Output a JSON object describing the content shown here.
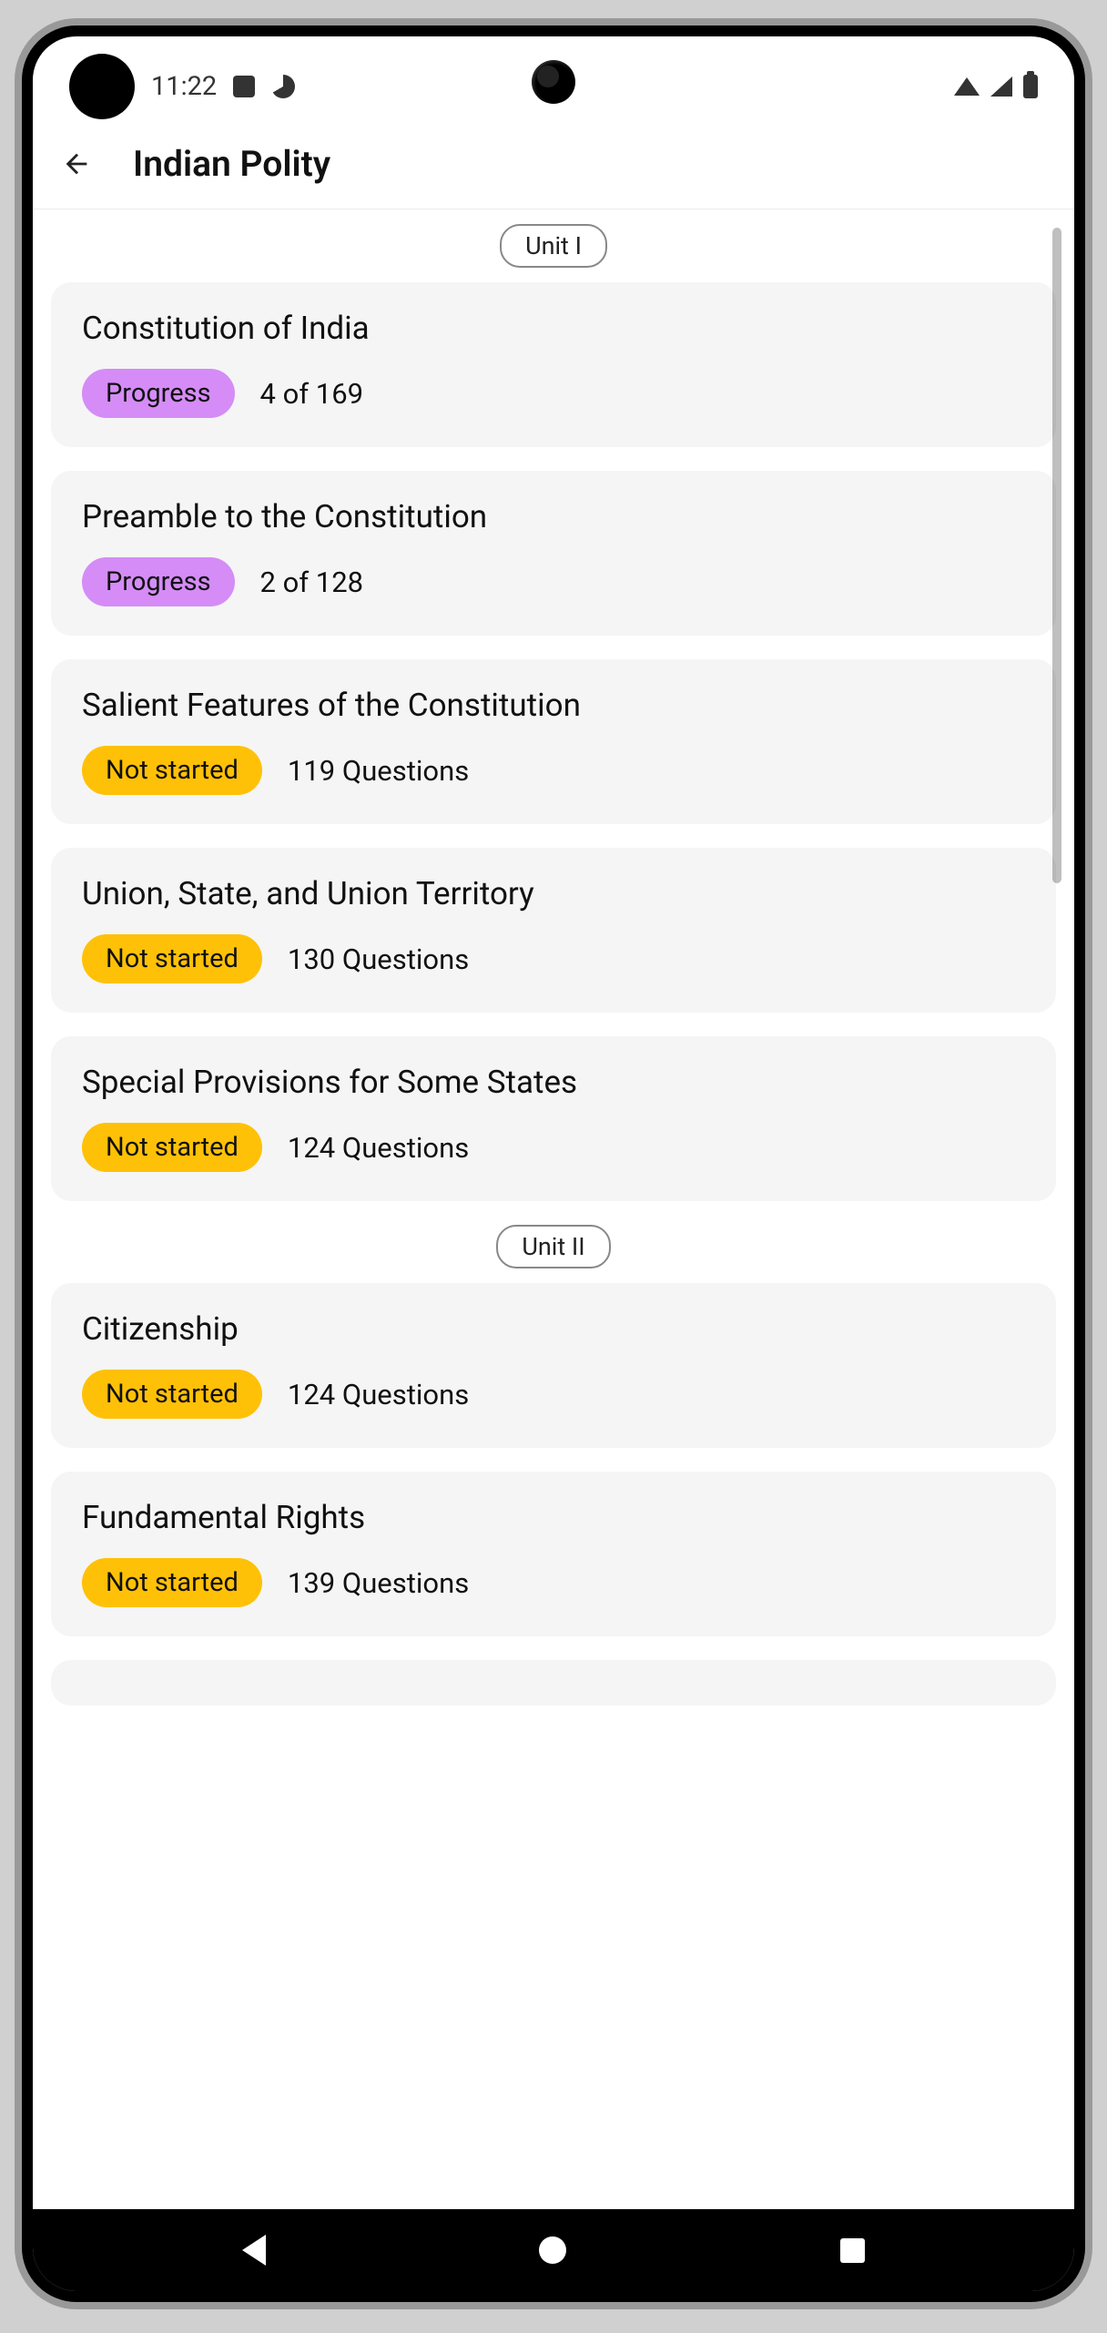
{
  "status_bar": {
    "time": "11:22"
  },
  "header": {
    "title": "Indian Polity"
  },
  "units": [
    {
      "label": "Unit I",
      "topics": [
        {
          "title": "Constitution of India",
          "status": "Progress",
          "status_type": "progress",
          "count_text": "4 of 169"
        },
        {
          "title": "Preamble to the Constitution",
          "status": "Progress",
          "status_type": "progress",
          "count_text": "2 of 128"
        },
        {
          "title": "Salient Features of the Constitution",
          "status": "Not started",
          "status_type": "not_started",
          "count_text": "119 Questions"
        },
        {
          "title": "Union, State, and Union Territory",
          "status": "Not started",
          "status_type": "not_started",
          "count_text": "130 Questions"
        },
        {
          "title": "Special Provisions for Some States",
          "status": "Not started",
          "status_type": "not_started",
          "count_text": "124 Questions"
        }
      ]
    },
    {
      "label": "Unit II",
      "topics": [
        {
          "title": "Citizenship",
          "status": "Not started",
          "status_type": "not_started",
          "count_text": "124 Questions"
        },
        {
          "title": "Fundamental Rights",
          "status": "Not started",
          "status_type": "not_started",
          "count_text": "139 Questions"
        }
      ]
    }
  ]
}
